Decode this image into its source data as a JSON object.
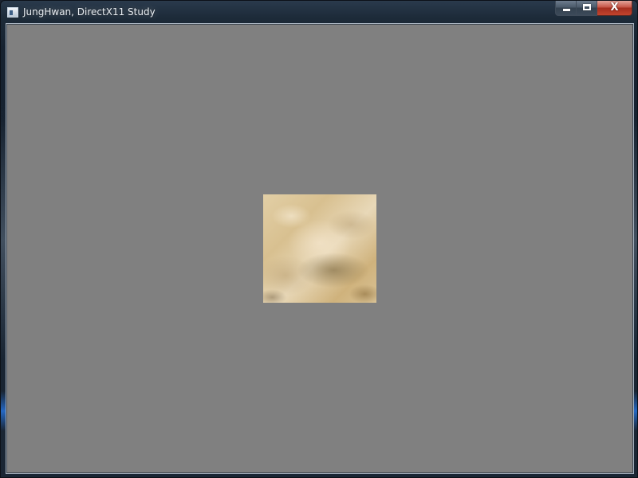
{
  "window": {
    "title": "JungHwan, DirectX11 Study",
    "icon": "app-window-icon",
    "buttons": {
      "minimize": "minimize-icon",
      "maximize": "maximize-icon",
      "close": "close-icon",
      "close_glyph": "X"
    }
  },
  "viewport": {
    "clear_color": "#808080",
    "textured_quad": {
      "texture": "sandstone",
      "base_color": "#d9c295"
    }
  },
  "colors": {
    "frame": "#1c2a38",
    "title_text": "#e9eef3",
    "close_button": "#c65546"
  }
}
